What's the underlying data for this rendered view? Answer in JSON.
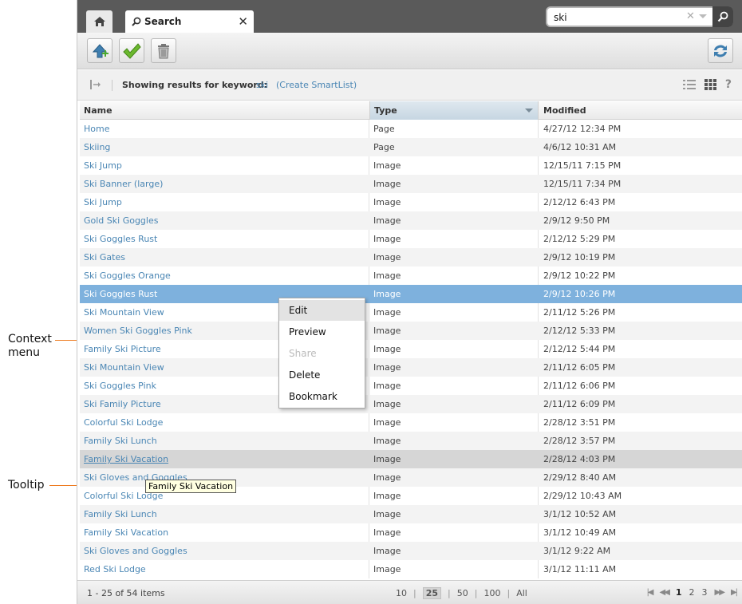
{
  "tabs": {
    "search_label": "Search",
    "close_glyph": "✕"
  },
  "search": {
    "value": "ski"
  },
  "toolbar": {
    "buttons": [
      {
        "name": "add-to-folder-button",
        "icon": "upload-arrow-icon"
      },
      {
        "name": "approve-button",
        "icon": "checkmark-icon"
      },
      {
        "name": "delete-button",
        "icon": "trash-icon"
      }
    ],
    "refresh_icon": "refresh-icon"
  },
  "results": {
    "label": "Showing results for keyword:",
    "keyword": "ski",
    "smartlist": "(Create SmartList)"
  },
  "grid": {
    "columns": [
      "Name",
      "Type",
      "Modified"
    ],
    "rows": [
      {
        "name": "Home",
        "type": "Page",
        "modified": "4/27/12 12:34 PM"
      },
      {
        "name": "Skiing",
        "type": "Page",
        "modified": "4/6/12 10:31 AM"
      },
      {
        "name": "Ski Jump",
        "type": "Image",
        "modified": "12/15/11 7:15 PM"
      },
      {
        "name": "Ski Banner (large)",
        "type": "Image",
        "modified": "12/15/11 7:34 PM"
      },
      {
        "name": "Ski Jump",
        "type": "Image",
        "modified": "2/12/12 6:43 PM"
      },
      {
        "name": "Gold Ski Goggles",
        "type": "Image",
        "modified": "2/9/12 9:50 PM"
      },
      {
        "name": "Ski Goggles Rust",
        "type": "Image",
        "modified": "2/12/12 5:29 PM"
      },
      {
        "name": "Ski Gates",
        "type": "Image",
        "modified": "2/9/12 10:19 PM"
      },
      {
        "name": "Ski Goggles Orange",
        "type": "Image",
        "modified": "2/9/12 10:22 PM"
      },
      {
        "name": "Ski Goggles Rust",
        "type": "Image",
        "modified": "2/9/12 10:26 PM",
        "state": "selected"
      },
      {
        "name": "Ski Mountain View",
        "type": "Image",
        "modified": "2/11/12 5:26 PM"
      },
      {
        "name": "Women Ski Goggles Pink",
        "type": "Image",
        "modified": "2/12/12 5:33 PM"
      },
      {
        "name": "Family Ski Picture",
        "type": "Image",
        "modified": "2/12/12 5:44 PM"
      },
      {
        "name": "Ski Mountain View",
        "type": "Image",
        "modified": "2/11/12 6:05 PM"
      },
      {
        "name": "Ski Goggles Pink",
        "type": "Image",
        "modified": "2/11/12 6:06 PM"
      },
      {
        "name": "Ski Family Picture",
        "type": "Image",
        "modified": "2/11/12 6:09 PM"
      },
      {
        "name": "Colorful Ski Lodge",
        "type": "Image",
        "modified": "2/28/12 3:51 PM"
      },
      {
        "name": "Family Ski Lunch",
        "type": "Image",
        "modified": "2/28/12 3:57 PM"
      },
      {
        "name": "Family Ski Vacation",
        "type": "Image",
        "modified": "2/28/12 4:03 PM",
        "state": "hovered"
      },
      {
        "name": "Ski Gloves and Goggles",
        "type": "Image",
        "modified": "2/29/12 8:40 AM"
      },
      {
        "name": "Colorful Ski Lodge",
        "type": "Image",
        "modified": "2/29/12 10:43 AM"
      },
      {
        "name": "Family Ski Lunch",
        "type": "Image",
        "modified": "3/1/12 10:52 AM"
      },
      {
        "name": "Family Ski Vacation",
        "type": "Image",
        "modified": "3/1/12 10:49 AM"
      },
      {
        "name": "Ski Gloves and Goggles",
        "type": "Image",
        "modified": "3/1/12 9:22 AM"
      },
      {
        "name": "Red Ski Lodge",
        "type": "Image",
        "modified": "3/1/12 11:11 AM"
      }
    ]
  },
  "footer": {
    "count": "1 - 25 of 54 items",
    "page_sizes": [
      "10",
      "25",
      "50",
      "100",
      "All"
    ],
    "current_size": "25",
    "pages": [
      "1",
      "2",
      "3"
    ],
    "current_page": "1"
  },
  "context_menu": {
    "items": [
      {
        "label": "Edit",
        "highlighted": true
      },
      {
        "label": "Preview"
      },
      {
        "label": "Share",
        "disabled": true
      },
      {
        "label": "Delete"
      },
      {
        "label": "Bookmark"
      }
    ]
  },
  "tooltip": {
    "text": "Family Ski Vacation"
  },
  "annotations": {
    "context_menu_label": "Context menu",
    "tooltip_label": "Tooltip",
    "color": "#ee7a1e"
  },
  "colors": {
    "accent_link": "#4a86b4",
    "selected_row": "#7eb1dd",
    "tabbar": "#5a5a5a"
  }
}
